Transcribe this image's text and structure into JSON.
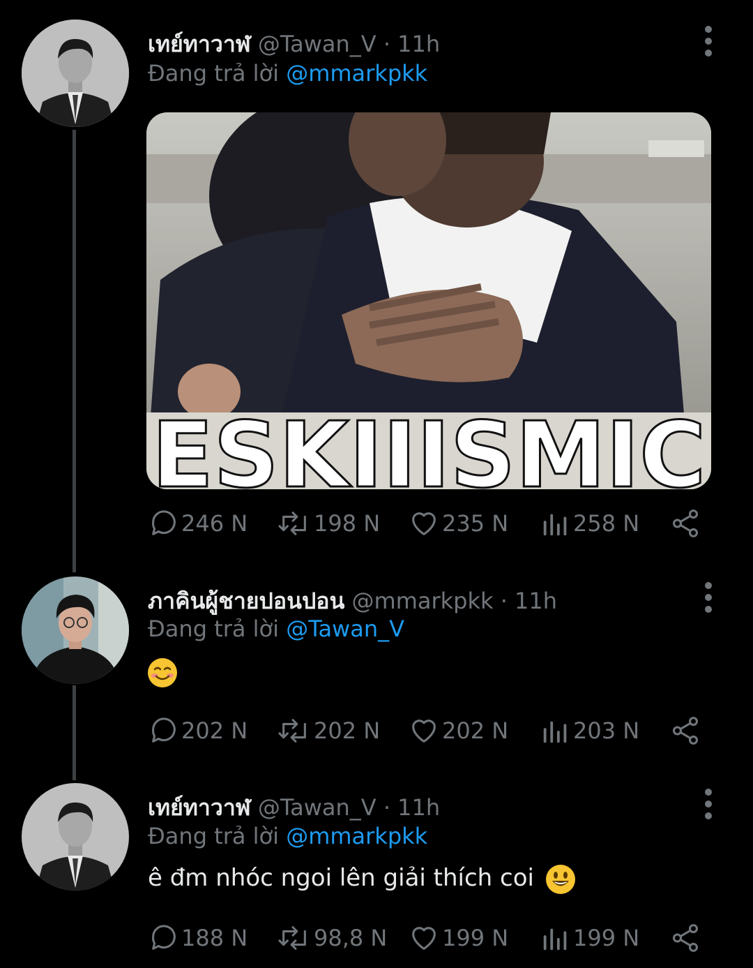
{
  "tweets": [
    {
      "display_name": "เทย์ทาวาฬ",
      "handle": "@Tawan_V",
      "dot": "·",
      "time": "11h",
      "reply_prefix": "Đang trả lời",
      "reply_to": "@mmarkpkk",
      "text": "",
      "image_caption": "ESKIIISMIC",
      "stats": {
        "replies": "246 N",
        "retweets": "198 N",
        "likes": "235 N",
        "views": "258 N"
      }
    },
    {
      "display_name": "ภาคินผู้ชายปอนปอน",
      "handle": "@mmarkpkk",
      "dot": "·",
      "time": "11h",
      "reply_prefix": "Đang trả lời",
      "reply_to": "@Tawan_V",
      "text": "",
      "emoji": "smiling-face-emoji",
      "stats": {
        "replies": "202 N",
        "retweets": "202 N",
        "likes": "202 N",
        "views": "203 N"
      }
    },
    {
      "display_name": "เทย์ทาวาฬ",
      "handle": "@Tawan_V",
      "dot": "·",
      "time": "11h",
      "reply_prefix": "Đang trả lời",
      "reply_to": "@mmarkpkk",
      "text": "ê đm nhóc ngoi lên giải thích coi",
      "emoji": "grinning-face-emoji",
      "stats": {
        "replies": "188 N",
        "retweets": "98,8 N",
        "likes": "199 N",
        "views": "199 N"
      }
    }
  ],
  "colors": {
    "background": "#000000",
    "text": "#e7e9ea",
    "muted": "#71767b",
    "link": "#1d9bf0",
    "thread_line": "#3e4144"
  }
}
